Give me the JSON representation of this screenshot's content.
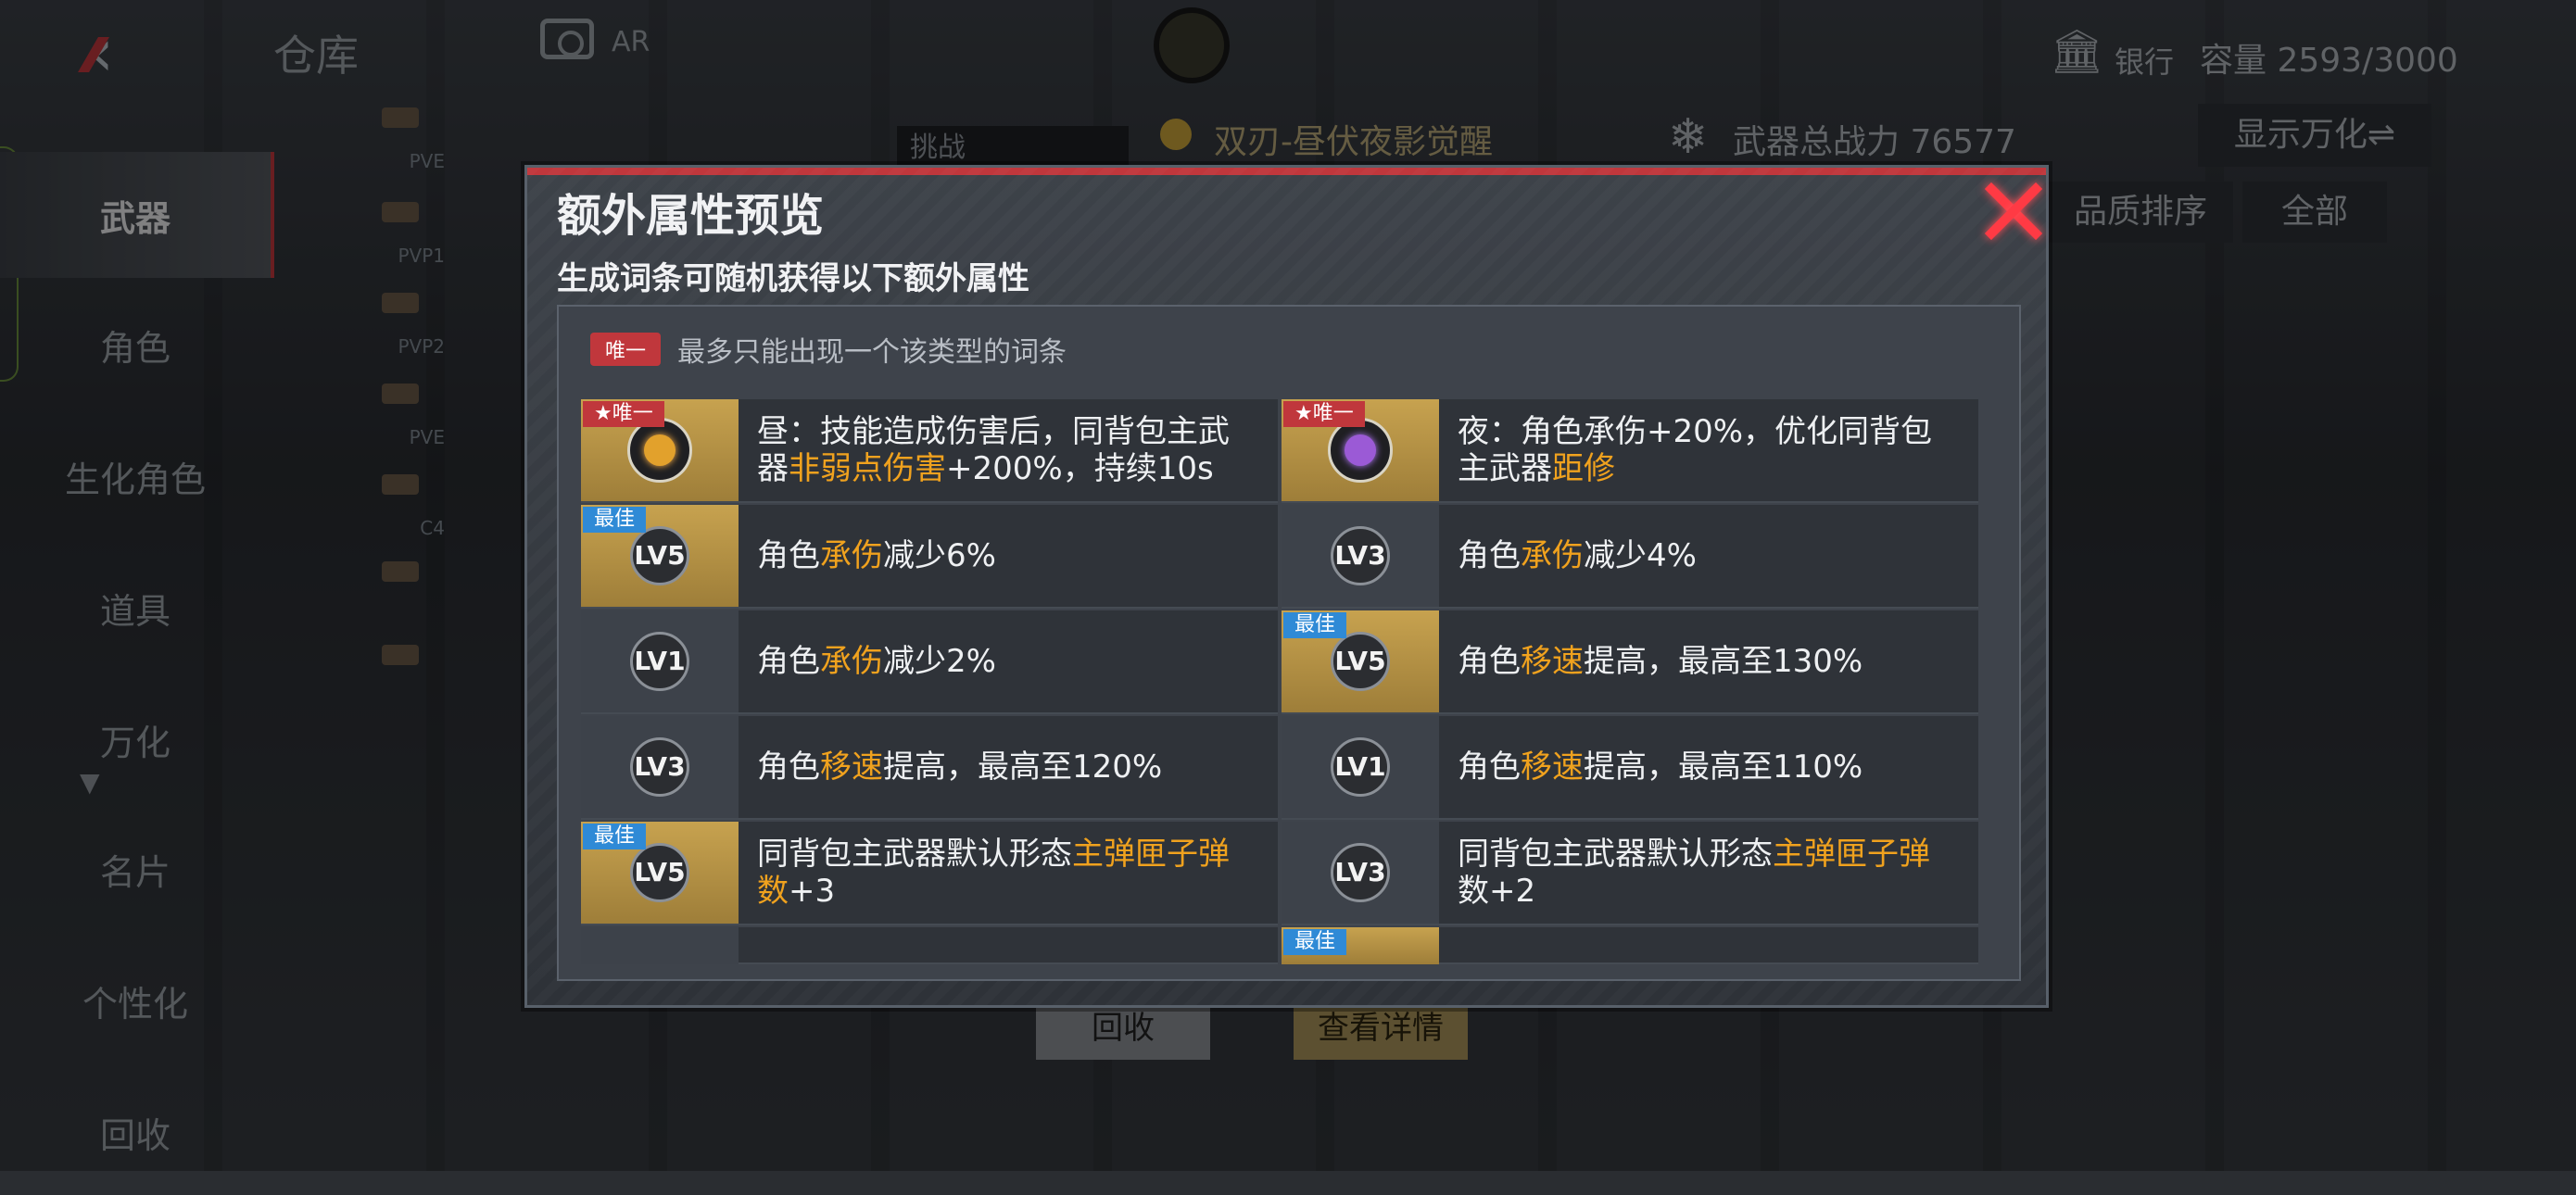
{
  "header": {
    "title": "仓库",
    "ar_label": "AR",
    "bank_label": "银行",
    "capacity": "容量 2593/3000"
  },
  "sidebar": {
    "items": [
      {
        "label": "武器"
      },
      {
        "label": "角色"
      },
      {
        "label": "生化角色"
      },
      {
        "label": "道具"
      },
      {
        "label": "万化"
      },
      {
        "label": "名片"
      },
      {
        "label": "个性化"
      },
      {
        "label": "回收"
      }
    ]
  },
  "thumbs": [
    {
      "tag": "PVE"
    },
    {
      "tag": "PVP1"
    },
    {
      "tag": "PVP2"
    },
    {
      "tag": "PVE"
    },
    {
      "tag": "C4"
    },
    {
      "tag": ""
    },
    {
      "tag": ""
    }
  ],
  "background": {
    "challenge": "挑战",
    "weapon_name": "双刃-昼伏夜影觉醒",
    "power": "武器总战力 76577",
    "toggle": "显示万化⇌",
    "sort": "品质排序",
    "all": "全部",
    "recycle": "回收",
    "details": "查看详情"
  },
  "modal": {
    "title": "额外属性预览",
    "subtitle": "生成词条可随机获得以下额外属性",
    "legend_pill": "唯一",
    "legend_text": "最多只能出现一个该类型的词条",
    "badge_unique": "★唯一",
    "badge_best": "最佳",
    "left": [
      {
        "level": "",
        "parts": [
          "昼：技能造成伤害后，同背包主武器",
          "非弱点伤害",
          "+200%，持续10s"
        ]
      },
      {
        "level": "LV5",
        "parts": [
          "角色",
          "承伤",
          "减少6%"
        ]
      },
      {
        "level": "LV1",
        "parts": [
          "角色",
          "承伤",
          "减少2%"
        ]
      },
      {
        "level": "LV3",
        "parts": [
          "角色",
          "移速",
          "提高，最高至120%"
        ]
      },
      {
        "level": "LV5",
        "parts": [
          "同背包主武器默认形态",
          "主弹匣子弹数",
          "+3"
        ]
      }
    ],
    "right": [
      {
        "level": "",
        "parts": [
          "夜：角色承伤+20%，优化同背包主武器",
          "距修",
          ""
        ]
      },
      {
        "level": "LV3",
        "parts": [
          "角色",
          "承伤",
          "减少4%"
        ]
      },
      {
        "level": "LV5",
        "parts": [
          "角色",
          "移速",
          "提高，最高至130%"
        ]
      },
      {
        "level": "LV1",
        "parts": [
          "角色",
          "移速",
          "提高，最高至110%"
        ]
      },
      {
        "level": "LV3",
        "parts": [
          "同背包主武器默认形态",
          "主弹匣子弹",
          "数+2"
        ]
      }
    ]
  }
}
